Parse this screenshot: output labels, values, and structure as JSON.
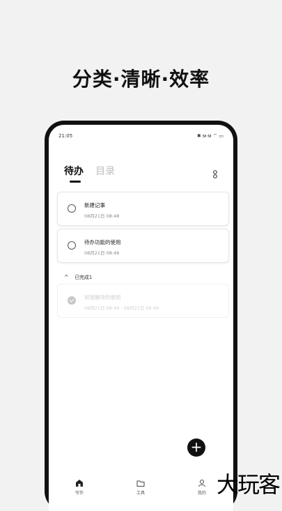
{
  "headline": "分类·清晰·效率",
  "status_bar": {
    "time": "21:05",
    "icons_text": "✱ ᵴᵼ ᵴᵼ ⌔ ▭"
  },
  "tabs": [
    {
      "label": "待办",
      "active": true
    },
    {
      "label": "目录",
      "active": false
    }
  ],
  "todos": [
    {
      "title": "新建记事",
      "time": "08月21日 08:48"
    },
    {
      "title": "待办功能的使用",
      "time": "08月21日 08:46"
    }
  ],
  "completed_section": {
    "label": "已完成1",
    "items": [
      {
        "title": "如接触块的使用",
        "time": "08月21日 08:46 - 08月21日 08:46"
      }
    ]
  },
  "fab_label": "+",
  "bottom_nav": [
    {
      "label": "写作",
      "icon": "home-icon"
    },
    {
      "label": "工具",
      "icon": "folder-icon"
    },
    {
      "label": "我的",
      "icon": "user-icon"
    }
  ],
  "watermark": "大玩客",
  "colors": {
    "background": "#f2f2f2",
    "phone_frame": "#111111",
    "accent": "#111111",
    "muted": "#bdbdbd"
  }
}
